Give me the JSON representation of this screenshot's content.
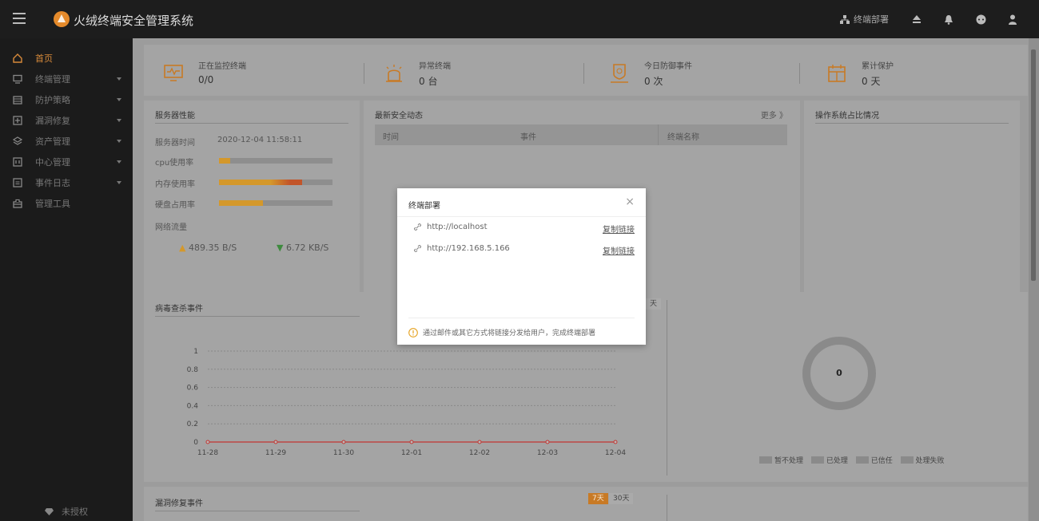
{
  "app": {
    "title": "火绒终端安全管理系统"
  },
  "topbar": {
    "deploy_label": "终端部署"
  },
  "sidebar": {
    "items": [
      {
        "label": "首页",
        "icon": "home-icon",
        "has_caret": false
      },
      {
        "label": "终端管理",
        "icon": "monitor-icon",
        "has_caret": true
      },
      {
        "label": "防护策略",
        "icon": "policy-icon",
        "has_caret": true
      },
      {
        "label": "漏洞修复",
        "icon": "patch-icon",
        "has_caret": true
      },
      {
        "label": "资产管理",
        "icon": "asset-icon",
        "has_caret": true
      },
      {
        "label": "中心管理",
        "icon": "center-icon",
        "has_caret": true
      },
      {
        "label": "事件日志",
        "icon": "log-icon",
        "has_caret": true
      },
      {
        "label": "管理工具",
        "icon": "tool-icon",
        "has_caret": false
      }
    ],
    "footer": "未授权"
  },
  "stats": [
    {
      "label": "正在监控终端",
      "value": "0/0"
    },
    {
      "label": "异常终端",
      "value": "0 台"
    },
    {
      "label": "今日防御事件",
      "value": "0 次"
    },
    {
      "label": "累计保护",
      "value": "0 天"
    }
  ],
  "server": {
    "title": "服务器性能",
    "time_label": "服务器时间",
    "time_value": "2020-12-04 11:58:11",
    "cpu_label": "cpu使用率",
    "mem_label": "内存使用率",
    "disk_label": "硬盘占用率",
    "net_label": "网络流量",
    "upload": "489.35 B/S",
    "download": "6.72 KB/S",
    "cpu_pct": 0.1,
    "mem_pct": 0.73,
    "disk_pct": 0.39
  },
  "security": {
    "title": "最新安全动态",
    "more": "更多 》",
    "columns": [
      "时间",
      "事件",
      "终端名称"
    ]
  },
  "os": {
    "title": "操作系统占比情况"
  },
  "virus": {
    "title": "病毒查杀事件",
    "tab_partial": "天",
    "donut_value": "0",
    "legend": [
      "暂不处理",
      "已处理",
      "已信任",
      "处理失败"
    ]
  },
  "vuln": {
    "title": "漏洞修复事件",
    "tab_7": "7天",
    "tab_30": "30天"
  },
  "modal": {
    "title": "终端部署",
    "close": "×",
    "links": [
      {
        "url": "http://localhost",
        "copy": "复制链接"
      },
      {
        "url": "http://192.168.5.166",
        "copy": "复制链接"
      }
    ],
    "tip": "通过邮件或其它方式将链接分发给用户，完成终端部署"
  },
  "chart_data": {
    "type": "line",
    "title": "病毒查杀事件",
    "categories": [
      "11-28",
      "11-29",
      "11-30",
      "12-01",
      "12-02",
      "12-03",
      "12-04"
    ],
    "series": [
      {
        "values": [
          0,
          0,
          0,
          0,
          0,
          0,
          0
        ],
        "color": "#c23531"
      }
    ],
    "yticks": [
      "0",
      "0.2",
      "0.4",
      "0.6",
      "0.8",
      "1"
    ],
    "ylim": [
      0,
      1
    ],
    "grid": true
  }
}
